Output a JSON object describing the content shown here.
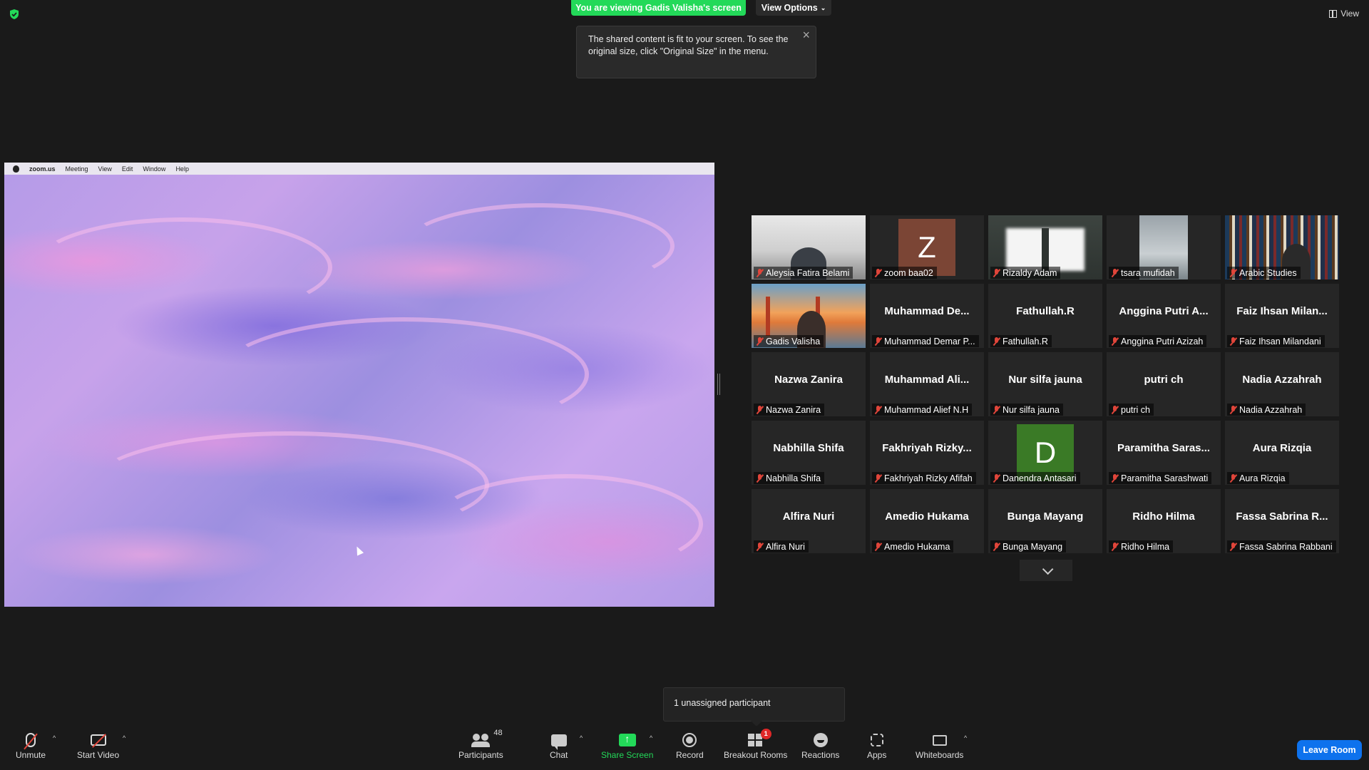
{
  "banner": {
    "viewing": "You are viewing Gadis Valisha's screen",
    "view_options": "View Options",
    "top_view": "View"
  },
  "tooltip": {
    "text": "The shared content is fit to your screen. To see the original size, click \"Original Size\" in the menu."
  },
  "shared_screen": {
    "menu": [
      "zoom.us",
      "Meeting",
      "View",
      "Edit",
      "Window",
      "Help"
    ]
  },
  "gallery": {
    "tiles": [
      {
        "label": "Aleysia Fatira Belami",
        "type": "photo",
        "photo": "room"
      },
      {
        "label": "zoom baa02",
        "type": "avatar",
        "letter": "Z",
        "color": "#7b4535"
      },
      {
        "label": "Rizaldy Adam",
        "type": "photo",
        "photo": "window"
      },
      {
        "label": "tsara mufidah",
        "type": "photo",
        "photo": "sky"
      },
      {
        "label": "Arabic Studies",
        "type": "photo",
        "photo": "books"
      },
      {
        "label": "Gadis Valisha",
        "type": "photo",
        "photo": "bridge",
        "active": true
      },
      {
        "label": "Muhammad Demar P...",
        "type": "name",
        "display": "Muhammad  De..."
      },
      {
        "label": "Fathullah.R",
        "type": "name",
        "display": "Fathullah.R"
      },
      {
        "label": "Anggina Putri Azizah",
        "type": "name",
        "display": "Anggina Putri A..."
      },
      {
        "label": "Faiz Ihsan Milandani",
        "type": "name",
        "display": "Faiz Ihsan Milan..."
      },
      {
        "label": "Nazwa Zanira",
        "type": "name",
        "display": "Nazwa Zanira"
      },
      {
        "label": "Muhammad Alief N.H",
        "type": "name",
        "display": "Muhammad  Ali..."
      },
      {
        "label": "Nur silfa jauna",
        "type": "name",
        "display": "Nur silfa jauna"
      },
      {
        "label": "putri ch",
        "type": "name",
        "display": "putri ch"
      },
      {
        "label": "Nadia Azzahrah",
        "type": "name",
        "display": "Nadia Azzahrah"
      },
      {
        "label": "Nabhilla Shifa",
        "type": "name",
        "display": "Nabhilla Shifa"
      },
      {
        "label": "Fakhriyah Rizky Afifah",
        "type": "name",
        "display": "Fakhriyah  Rizky..."
      },
      {
        "label": "Danendra Antasari",
        "type": "avatar",
        "letter": "D",
        "color": "#3a7a26"
      },
      {
        "label": "Paramitha Sarashwati",
        "type": "name",
        "display": "Paramitha  Saras..."
      },
      {
        "label": "Aura Rizqia",
        "type": "name",
        "display": "Aura Rizqia"
      },
      {
        "label": "Alfira Nuri",
        "type": "name",
        "display": "Alfira Nuri"
      },
      {
        "label": "Amedio Hukama",
        "type": "name",
        "display": "Amedio Hukama"
      },
      {
        "label": "Bunga Mayang",
        "type": "name",
        "display": "Bunga Mayang"
      },
      {
        "label": "Ridho Hilma",
        "type": "name",
        "display": "Ridho Hilma"
      },
      {
        "label": "Fassa Sabrina Rabbani",
        "type": "name",
        "display": "Fassa Sabrina R..."
      }
    ]
  },
  "notice": {
    "unassigned": "1 unassigned participant"
  },
  "toolbar": {
    "unmute": "Unmute",
    "start_video": "Start Video",
    "participants": "Participants",
    "participants_count": "48",
    "chat": "Chat",
    "share_screen": "Share Screen",
    "record": "Record",
    "breakout_rooms": "Breakout Rooms",
    "breakout_badge": "1",
    "reactions": "Reactions",
    "apps": "Apps",
    "whiteboards": "Whiteboards",
    "leave": "Leave Room"
  },
  "colors": {
    "share_green": "#23d959",
    "leave_blue": "#0e72ed",
    "active_speaker": "#e9ea70",
    "muted_red": "#e0453a"
  }
}
